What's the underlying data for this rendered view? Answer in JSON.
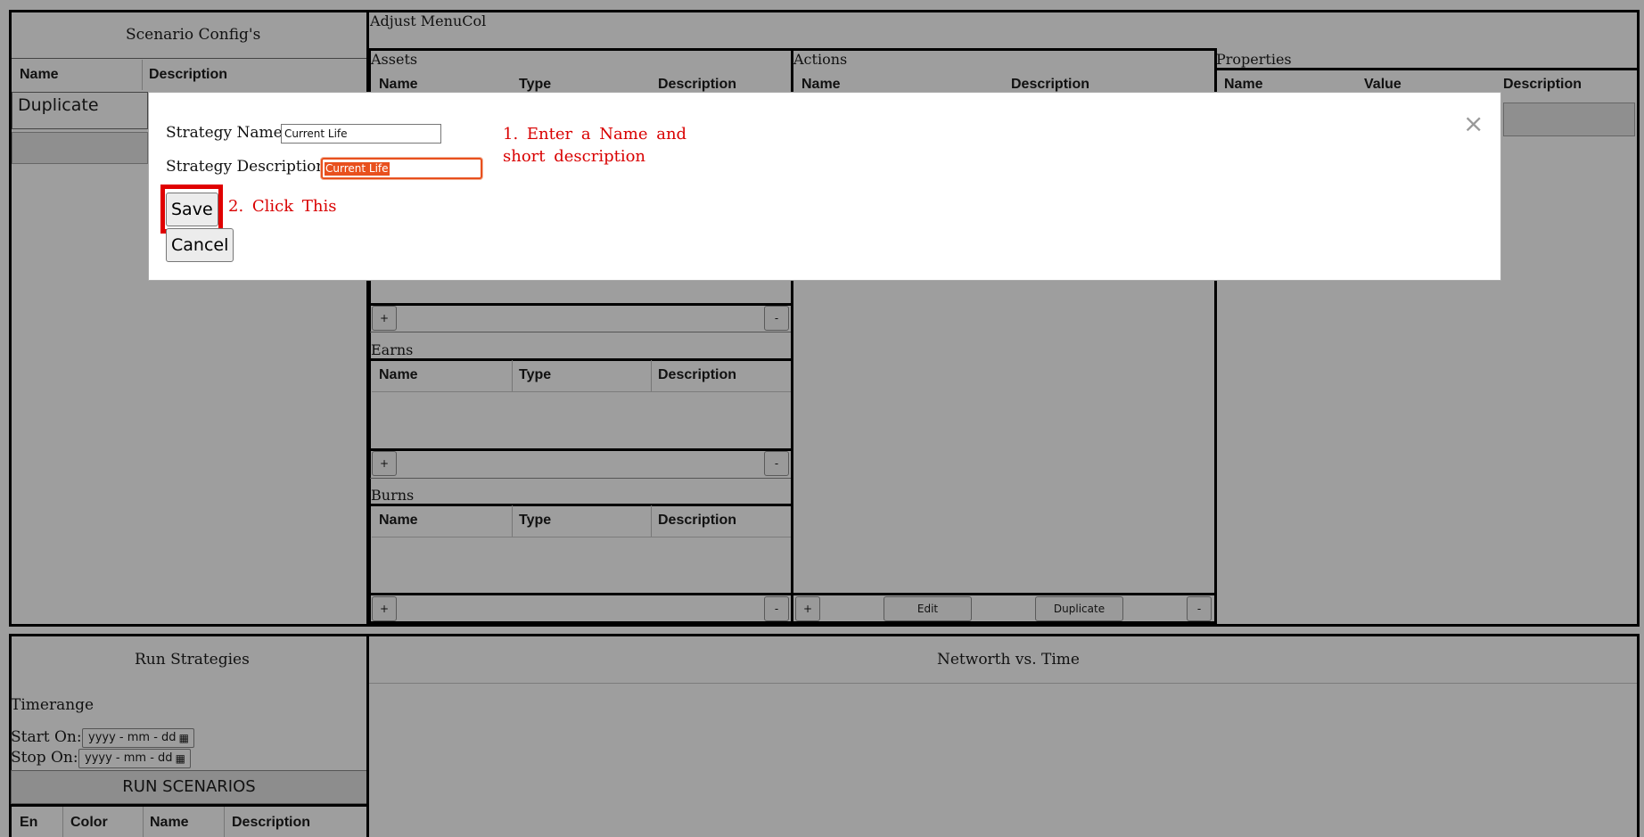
{
  "left_panel": {
    "title": "Scenario Config's",
    "columns": [
      "Name",
      "Description"
    ],
    "row_name": "Duplicate"
  },
  "adjust": {
    "title": "Adjust MenuCol",
    "assets": {
      "title": "Assets",
      "columns": [
        "Name",
        "Type",
        "Description"
      ]
    },
    "earns": {
      "title": "Earns",
      "columns": [
        "Name",
        "Type",
        "Description"
      ]
    },
    "burns": {
      "title": "Burns",
      "columns": [
        "Name",
        "Type",
        "Description"
      ]
    },
    "actions": {
      "title": "Actions",
      "columns": [
        "Name",
        "Description"
      ]
    },
    "properties": {
      "title": "Properties",
      "columns": [
        "Name",
        "Value",
        "Description"
      ]
    },
    "plus": "+",
    "minus": "-",
    "edit": "Edit",
    "duplicate": "Duplicate"
  },
  "run": {
    "title": "Run Strategies",
    "timerange": "Timerange",
    "start_label": "Start On:",
    "stop_label": "Stop On:",
    "date_placeholder": "yyyy - mm - dd",
    "run_button": "RUN SCENARIOS",
    "columns": [
      "En",
      "Color",
      "Name",
      "Description"
    ]
  },
  "chart": {
    "title": "Networth vs. Time"
  },
  "modal": {
    "name_label": "Strategy Name:",
    "name_value": "Current Life",
    "desc_label": "Strategy Description:",
    "desc_value": "Current Life",
    "save": "Save",
    "cancel": "Cancel",
    "close": "×",
    "note1_line1": "1. Enter a Name and",
    "note1_line2": "short description",
    "note2": "2. Click This"
  },
  "colors": {
    "background": "#9e9e9e",
    "annotation": "#d90000",
    "highlight": "#e8501e"
  }
}
